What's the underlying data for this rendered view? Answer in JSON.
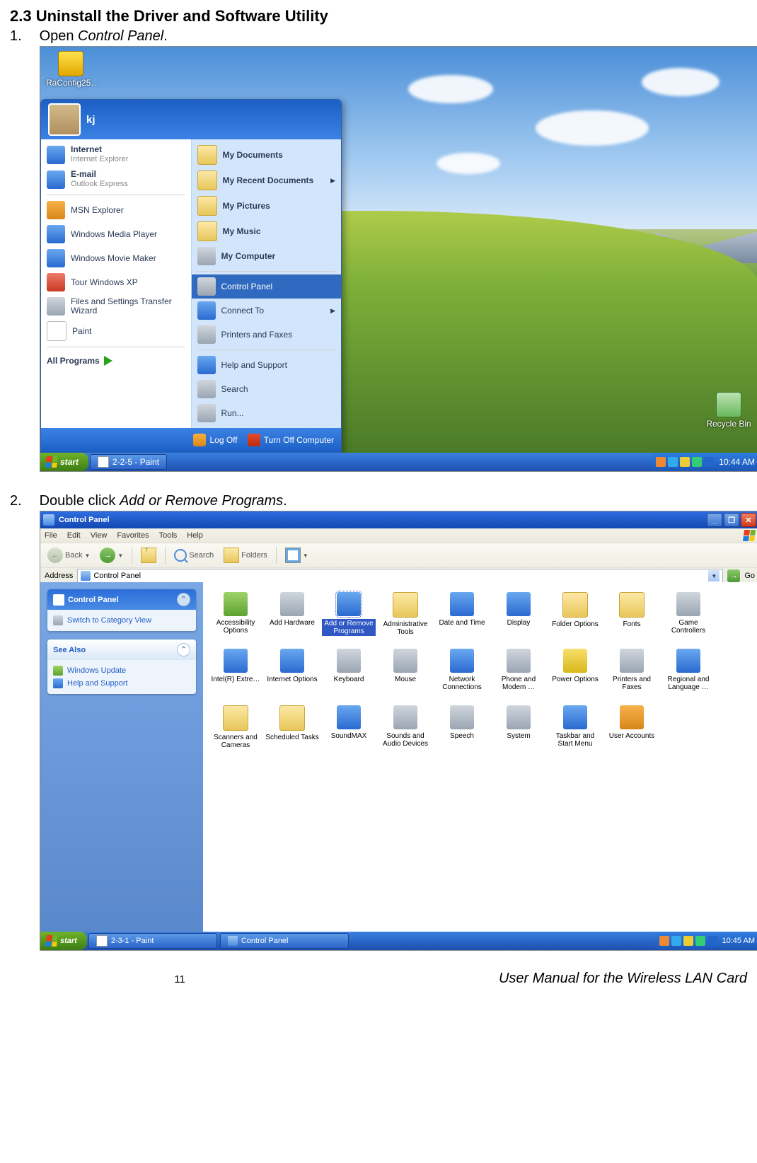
{
  "doc": {
    "heading": "2.3 Uninstall the Driver and Software Utility",
    "step1_num": "1.",
    "step1_text_a": "Open ",
    "step1_text_b": "Control Panel",
    "step1_text_c": ".",
    "step2_num": "2.",
    "step2_text_a": "Double click ",
    "step2_text_b": "Add or Remove Programs",
    "step2_text_c": ".",
    "page_number": "11",
    "footer": "User Manual for the Wireless LAN Card"
  },
  "shot1": {
    "desktop_icons": {
      "raconfig": "RaConfig25…",
      "recycle": "Recycle Bin"
    },
    "startmenu": {
      "user": "kj",
      "left": [
        {
          "title": "Internet",
          "sub": "Internet Explorer",
          "icon": "col-blue"
        },
        {
          "title": "E-mail",
          "sub": "Outlook Express",
          "icon": "col-blue"
        },
        {
          "title": "MSN Explorer",
          "icon": "col-orange"
        },
        {
          "title": "Windows Media Player",
          "icon": "col-blue"
        },
        {
          "title": "Windows Movie Maker",
          "icon": "col-blue"
        },
        {
          "title": "Tour Windows XP",
          "icon": "col-red"
        },
        {
          "title": "Files and Settings Transfer Wizard",
          "icon": "col-gray"
        },
        {
          "title": "Paint",
          "icon": "col-white"
        }
      ],
      "all_programs": "All Programs",
      "right": [
        {
          "title": "My Documents",
          "icon": "col-folder",
          "bold": true
        },
        {
          "title": "My Recent Documents",
          "icon": "col-folder",
          "bold": true,
          "arrow": true
        },
        {
          "title": "My Pictures",
          "icon": "col-folder",
          "bold": true
        },
        {
          "title": "My Music",
          "icon": "col-folder",
          "bold": true
        },
        {
          "title": "My Computer",
          "icon": "col-gray",
          "bold": true
        },
        {
          "sep": true
        },
        {
          "title": "Control Panel",
          "icon": "col-gray",
          "hover": true
        },
        {
          "title": "Connect To",
          "icon": "col-blue",
          "arrow": true
        },
        {
          "title": "Printers and Faxes",
          "icon": "col-gray"
        },
        {
          "sep": true
        },
        {
          "title": "Help and Support",
          "icon": "col-blue"
        },
        {
          "title": "Search",
          "icon": "col-gray"
        },
        {
          "title": "Run...",
          "icon": "col-gray"
        }
      ],
      "footer": {
        "logoff": "Log Off",
        "shutdown": "Turn Off Computer"
      }
    },
    "taskbar": {
      "start": "start",
      "task1": "2-2-5 - Paint",
      "clock": "10:44 AM"
    }
  },
  "shot2": {
    "title": "Control Panel",
    "menus": [
      "File",
      "Edit",
      "View",
      "Favorites",
      "Tools",
      "Help"
    ],
    "toolbar": {
      "back": "Back",
      "search": "Search",
      "folders": "Folders"
    },
    "address": {
      "label": "Address",
      "value": "Control Panel",
      "go": "Go"
    },
    "side": {
      "box1_title": "Control Panel",
      "box1_link": "Switch to Category View",
      "box2_title": "See Also",
      "box2_links": [
        "Windows Update",
        "Help and Support"
      ]
    },
    "icons": [
      {
        "l": "Accessibility Options",
        "c": "col-green"
      },
      {
        "l": "Add Hardware",
        "c": "col-gray"
      },
      {
        "l": "Add or Remove Programs",
        "c": "col-blue",
        "sel": true
      },
      {
        "l": "Administrative Tools",
        "c": "col-folder"
      },
      {
        "l": "Date and Time",
        "c": "col-blue"
      },
      {
        "l": "Display",
        "c": "col-blue"
      },
      {
        "l": "Folder Options",
        "c": "col-folder"
      },
      {
        "l": "Fonts",
        "c": "col-folder"
      },
      {
        "l": "Game Controllers",
        "c": "col-gray"
      },
      {
        "l": "Intel(R) Extre…",
        "c": "col-blue"
      },
      {
        "l": "Internet Options",
        "c": "col-blue"
      },
      {
        "l": "Keyboard",
        "c": "col-gray"
      },
      {
        "l": "Mouse",
        "c": "col-gray"
      },
      {
        "l": "Network Connections",
        "c": "col-blue"
      },
      {
        "l": "Phone and Modem …",
        "c": "col-gray"
      },
      {
        "l": "Power Options",
        "c": "col-yellow"
      },
      {
        "l": "Printers and Faxes",
        "c": "col-gray"
      },
      {
        "l": "Regional and Language …",
        "c": "col-blue"
      },
      {
        "l": "Scanners and Cameras",
        "c": "col-folder"
      },
      {
        "l": "Scheduled Tasks",
        "c": "col-folder"
      },
      {
        "l": "SoundMAX",
        "c": "col-blue"
      },
      {
        "l": "Sounds and Audio Devices",
        "c": "col-gray"
      },
      {
        "l": "Speech",
        "c": "col-gray"
      },
      {
        "l": "System",
        "c": "col-gray"
      },
      {
        "l": "Taskbar and Start Menu",
        "c": "col-blue"
      },
      {
        "l": "User Accounts",
        "c": "col-orange"
      }
    ],
    "taskbar": {
      "start": "start",
      "task1": "2-3-1 - Paint",
      "task2": "Control Panel",
      "clock": "10:45 AM"
    }
  }
}
